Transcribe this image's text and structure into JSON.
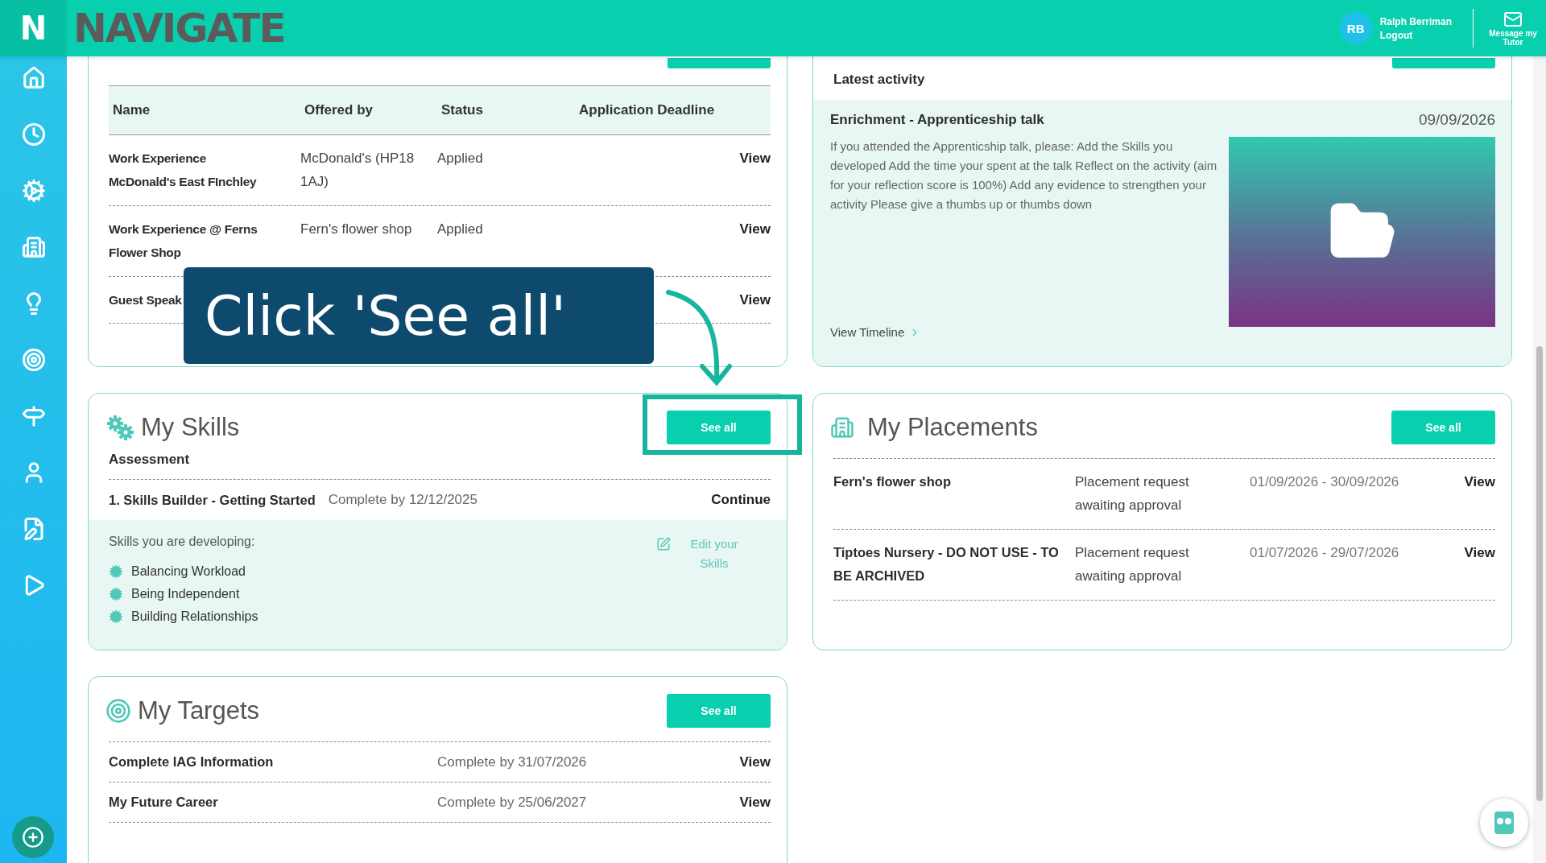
{
  "header": {
    "logo_letter": "N",
    "brand": "NAVIGATE",
    "user": {
      "initials": "RB",
      "name": "Ralph Berriman",
      "logout": "Logout"
    },
    "message": "Message my Tutor"
  },
  "applications": {
    "columns": [
      "Name",
      "Offered by",
      "Status",
      "Application Deadline"
    ],
    "rows": [
      {
        "name": "Work Experience McDonald's East FInchley",
        "offered_by": "McDonald's (HP18 1AJ)",
        "status": "Applied",
        "action": "View"
      },
      {
        "name": "Work Experience @ Ferns Flower Shop",
        "offered_by": "Fern's flower shop",
        "status": "Applied",
        "action": "View"
      },
      {
        "name": "Guest Speak",
        "action": "View"
      }
    ]
  },
  "activity": {
    "heading": "Latest activity",
    "title": "Enrichment - Apprenticeship talk",
    "date": "09/09/2026",
    "description": "If you attended the Apprenticship talk, please: Add the Skills you developed Add the time your spent at the talk Reflect on the activity (aim for your reflection score is 100%) Add any evidence to strengthen your activity Please give a thumbs up or thumbs down",
    "link": "View Timeline"
  },
  "skills": {
    "title": "My Skills",
    "button": "See all",
    "subtitle": "Assessment",
    "assessment": {
      "name": "1. Skills Builder - Getting Started",
      "due": "Complete by 12/12/2025",
      "action": "Continue"
    },
    "developing_label": "Skills you are developing:",
    "edit_link": "Edit your Skills",
    "items": [
      "Balancing Workload",
      "Being Independent",
      "Building Relationships"
    ]
  },
  "placements": {
    "title": "My Placements",
    "button": "See all",
    "rows": [
      {
        "name": "Fern's flower shop",
        "status": "Placement request awaiting approval",
        "dates": "01/09/2026 - 30/09/2026",
        "action": "View"
      },
      {
        "name": "Tiptoes Nursery - DO NOT USE - TO BE ARCHIVED",
        "status": "Placement request awaiting approval",
        "dates": "01/07/2026 - 29/07/2026",
        "action": "View"
      }
    ]
  },
  "targets": {
    "title": "My Targets",
    "button": "See all",
    "rows": [
      {
        "name": "Complete IAG Information",
        "due": "Complete by 31/07/2026",
        "action": "View"
      },
      {
        "name": "My Future Career",
        "due": "Complete by 25/06/2027",
        "action": "View"
      }
    ]
  },
  "callout": {
    "text": "Click 'See all'"
  }
}
